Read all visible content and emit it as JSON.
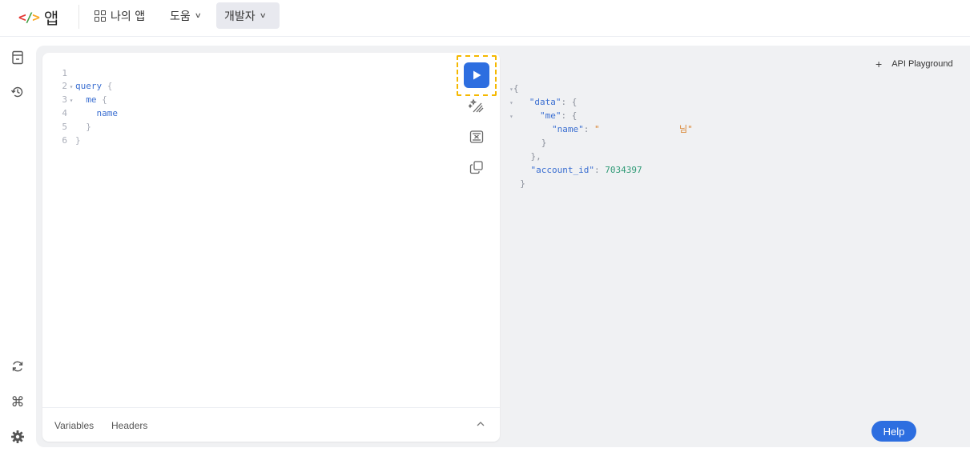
{
  "header": {
    "logo_mark": {
      "lt": "<",
      "slash": "/",
      "gt": ">"
    },
    "logo_text": "앱",
    "nav": [
      {
        "label": "나의 앱",
        "icon": "grid-icon"
      },
      {
        "label": "도움",
        "has_dropdown": true
      },
      {
        "label": "개발자",
        "has_dropdown": true,
        "active": true
      }
    ]
  },
  "sidebar": {
    "top_icons": [
      "document-icon",
      "history-icon"
    ],
    "bottom_icons": [
      "refresh-icon",
      "command-icon",
      "settings-icon"
    ]
  },
  "editor": {
    "lines": [
      {
        "num": "1",
        "text": ""
      },
      {
        "num": "2",
        "keyword": "query",
        "brace": "{"
      },
      {
        "num": "3",
        "field": "me",
        "brace": "{"
      },
      {
        "num": "4",
        "field": "name"
      },
      {
        "num": "5",
        "brace": "}"
      },
      {
        "num": "6",
        "brace": "}"
      }
    ],
    "toolbar": [
      "run-icon",
      "prettify-icon",
      "merge-icon",
      "copy-icon"
    ],
    "footer_tabs": [
      "Variables",
      "Headers"
    ]
  },
  "result": {
    "open_brace": "{",
    "data_key": "\"data\"",
    "me_key": "\"me\"",
    "name_key": "\"name\"",
    "name_value_open": "\"",
    "name_value_suffix": "님\"",
    "account_key": "\"account_id\"",
    "account_value": "7034397",
    "colon": ": ",
    "brace": "{",
    "close_brace": "}",
    "close_brace_comma": "},"
  },
  "tabs": {
    "playground_label": "API Playground",
    "plus": "+"
  },
  "help": {
    "label": "Help"
  },
  "colors": {
    "accent": "#2d6ee0",
    "highlight": "#f5b800",
    "keyword": "#3b6fd1",
    "string": "#d9822b",
    "number": "#2f9a76"
  }
}
